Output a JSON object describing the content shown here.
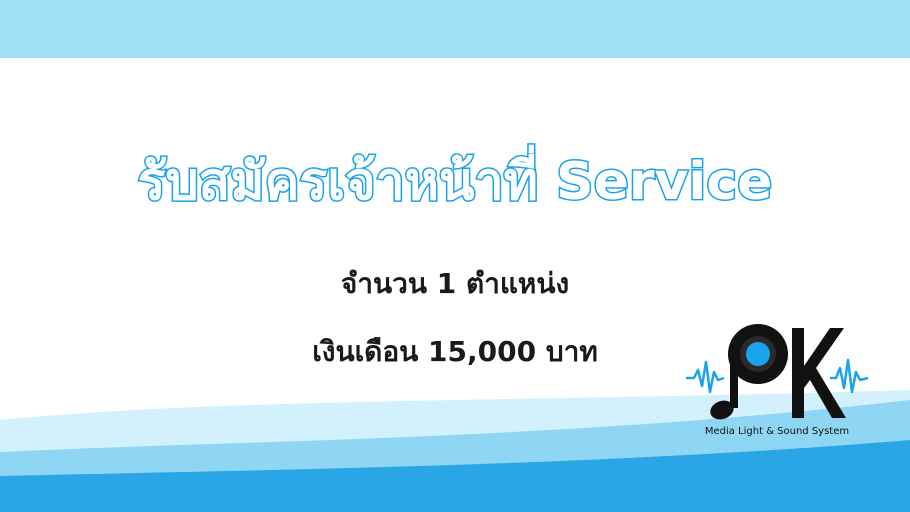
{
  "headline": "รับสมัครเจ้าหน้าที่ Service",
  "positions": "จำนวน 1 ตำแหน่ง",
  "salary": "เงินเดือน 15,000 บาท",
  "logo": {
    "letters": "PK",
    "tagline": "Media Light & Sound System"
  },
  "colors": {
    "top_band": "#a3e1f8",
    "headline_outline": "#1aa3ec",
    "wave_light": "#cdeffb",
    "wave_mid": "#7ecff3",
    "wave_dark": "#2aa6e6",
    "text": "#1a1a1a"
  }
}
